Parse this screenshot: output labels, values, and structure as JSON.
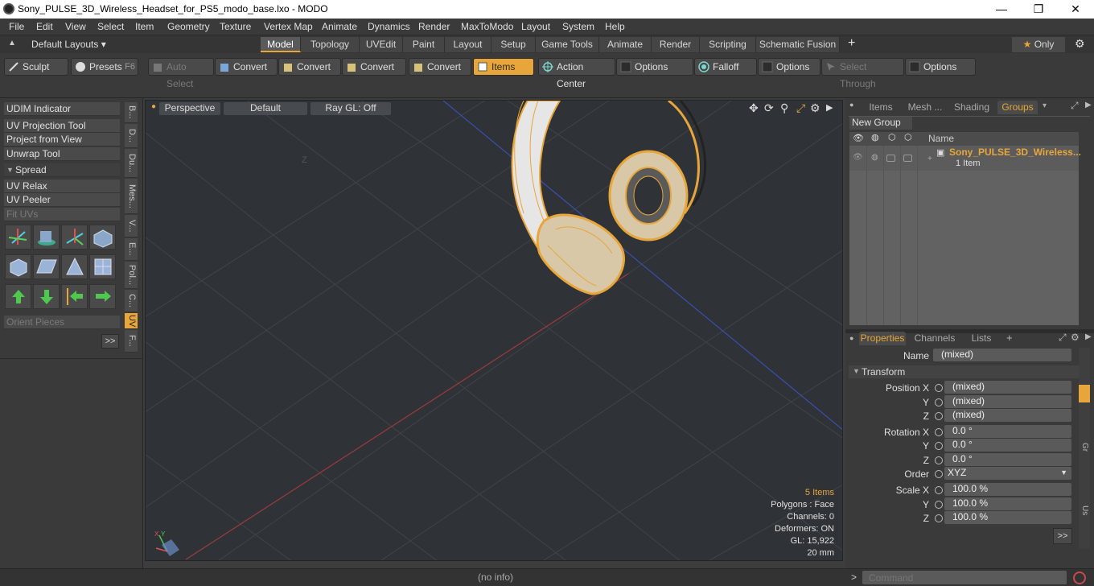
{
  "window": {
    "title": "Sony_PULSE_3D_Wireless_Headset_for_PS5_modo_base.lxo - MODO",
    "minimize": "—",
    "maximize": "❐",
    "close": "✕"
  },
  "menubar": [
    "File",
    "Edit",
    "View",
    "Select",
    "Item",
    "Geometry",
    "Texture",
    "Vertex Map",
    "Animate",
    "Dynamics",
    "Render",
    "MaxToModo",
    "Layout",
    "System",
    "Help"
  ],
  "layoutbar": {
    "layout_label": "Default Layouts",
    "tabs": [
      "Model",
      "Topology",
      "UVEdit",
      "Paint",
      "Layout",
      "Setup",
      "Game Tools",
      "Animate",
      "Render",
      "Scripting",
      "Schematic Fusion"
    ],
    "active_tab": "Model",
    "plus": "+",
    "only_label": "Only",
    "star": "★"
  },
  "toolbar": {
    "sculpt": "Sculpt",
    "presets": "Presets",
    "presets_key": "F6",
    "auto_select": "Auto Select",
    "convert1": "Convert",
    "convert2": "Convert",
    "convert3": "Convert",
    "convert4": "Convert",
    "items": "Items",
    "action_center": "Action Center",
    "options1": "Options",
    "falloff": "Falloff",
    "options2": "Options",
    "select_through": "Select Through",
    "options3": "Options"
  },
  "leftpanel": {
    "buttons": [
      "UDIM Indicator",
      "UV Projection Tool",
      "Project from View",
      "Unwrap Tool"
    ],
    "spread": "Spread",
    "buttons2": [
      "UV Relax",
      "UV Peeler"
    ],
    "fit_uvs": "Fit UVs",
    "orient_pieces": "Orient Pieces",
    "more": ">>",
    "vtabs": [
      "B...",
      "D...",
      "Du...",
      "Mes...",
      "V...",
      "E...",
      "Pol...",
      "C...",
      "UV",
      "F..."
    ],
    "active_vtab": "UV"
  },
  "viewport": {
    "perspective": "Perspective",
    "default": "Default",
    "raygl": "Ray GL: Off",
    "stats": {
      "items": "5 Items",
      "polygons": "Polygons : Face",
      "channels": "Channels: 0",
      "deformers": "Deformers: ON",
      "gl": "GL: 15,922",
      "scale": "20 mm"
    },
    "axis_z": "Z",
    "axis_x": "X",
    "axis_y": "Y"
  },
  "groups_panel": {
    "tabs": [
      "Items",
      "Mesh ...",
      "Shading",
      "Groups"
    ],
    "active_tab": "Groups",
    "new_group": "New Group",
    "col_name": "Name",
    "row_name": "Sony_PULSE_3D_Wireless...",
    "row_sub": "1 Item"
  },
  "properties_panel": {
    "tabs": [
      "Properties",
      "Channels",
      "Lists"
    ],
    "active_tab": "Properties",
    "plus": "+",
    "name_label": "Name",
    "name_value": "(mixed)",
    "transform": "Transform",
    "position_x_label": "Position X",
    "position_x": "(mixed)",
    "position_y": "(mixed)",
    "position_z": "(mixed)",
    "rotation_x_label": "Rotation X",
    "rotation_x": "0.0 °",
    "rotation_y": "0.0 °",
    "rotation_z": "0.0 °",
    "order_label": "Order",
    "order_value": "XYZ",
    "scale_x_label": "Scale X",
    "scale_x": "100.0 %",
    "scale_y": "100.0 %",
    "scale_z": "100.0 %",
    "y": "Y",
    "z": "Z",
    "more": ">>",
    "side_gr": "Gr",
    "side_us": "Us"
  },
  "statusbar": {
    "info": "(no info)",
    "command_placeholder": "Command",
    "prompt": ">"
  },
  "colors": {
    "accent": "#e8a63a",
    "viewport_bg": "#2f3337",
    "panel_bg": "#3a3a3a"
  }
}
